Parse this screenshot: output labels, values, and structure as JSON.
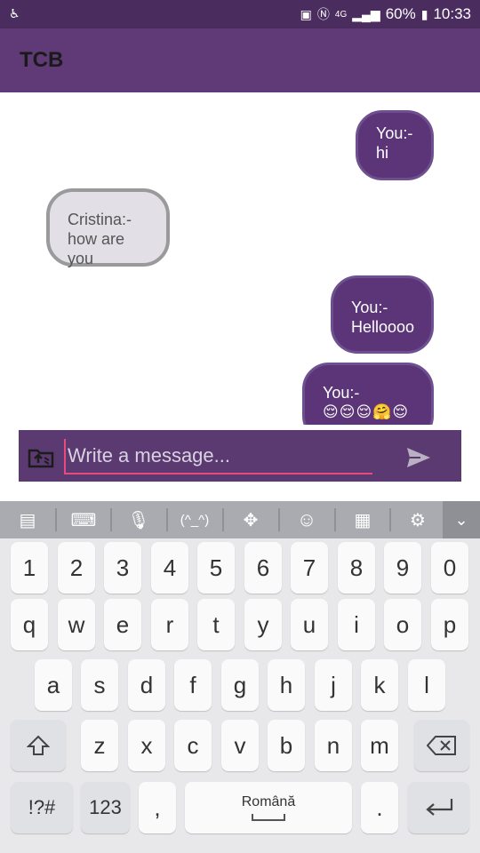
{
  "status_bar": {
    "left_icon": "accessibility-icon",
    "network": "4G",
    "battery": "60%",
    "time": "10:33"
  },
  "app_bar": {
    "title": "TCB"
  },
  "messages": [
    {
      "sender": "You:-",
      "text": "hi"
    },
    {
      "sender": "Cristina:-",
      "text": "how are you"
    },
    {
      "sender": "You:-",
      "text": "Helloooo"
    },
    {
      "sender": "You:-",
      "text": "😌😌😌🤗😌"
    }
  ],
  "composer": {
    "placeholder": "Write a message..."
  },
  "keyboard": {
    "toolbar": [
      "clipboard-icon",
      "keyboard-icon",
      "microphone-icon",
      "(^_^)",
      "move-cursor-icon",
      "emoji-icon",
      "one-hand-icon",
      "settings-icon",
      "hide-keyboard-icon"
    ],
    "rows": [
      [
        "1",
        "2",
        "3",
        "4",
        "5",
        "6",
        "7",
        "8",
        "9",
        "0"
      ],
      [
        "q",
        "w",
        "e",
        "r",
        "t",
        "y",
        "u",
        "i",
        "o",
        "p"
      ],
      [
        "a",
        "s",
        "d",
        "f",
        "g",
        "h",
        "j",
        "k",
        "l"
      ],
      [
        "z",
        "x",
        "c",
        "v",
        "b",
        "n",
        "m"
      ]
    ],
    "symbols_label": "!?#",
    "numbers_label": "123",
    "comma_label": ",",
    "space_label": "Română",
    "period_label": "."
  },
  "colors": {
    "app_bar": "#5f3a76",
    "status_bar": "#4a2c5e",
    "my_bubble": "#5b3577",
    "their_bubble": "#e2e0e6",
    "accent": "#e84a7f"
  }
}
